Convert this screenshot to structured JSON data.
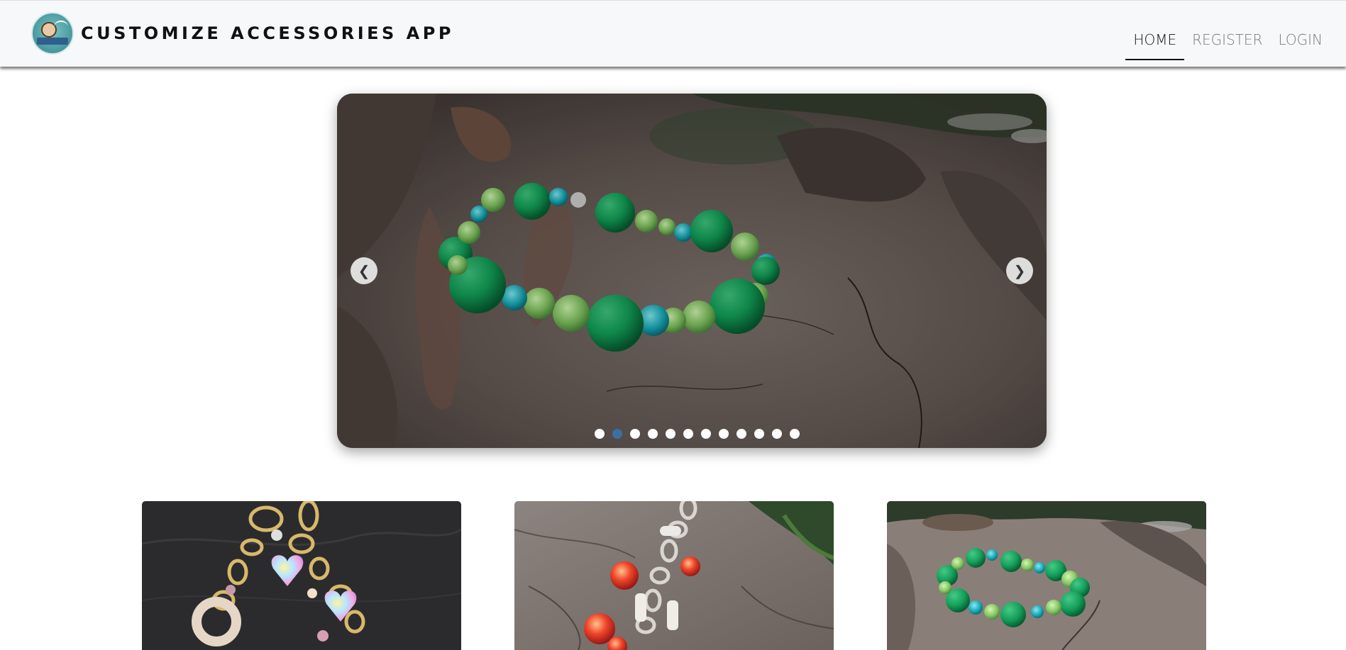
{
  "header": {
    "brand_title": "CUSTOMIZE ACCESSORIES APP",
    "logo_icon": "brand-logo-icon",
    "nav": [
      {
        "label": "HOME",
        "active": true
      },
      {
        "label": "REGISTER",
        "active": false
      },
      {
        "label": "LOGIN",
        "active": false
      }
    ]
  },
  "carousel": {
    "prev_symbol": "❮",
    "next_symbol": "❯",
    "slide_count": 12,
    "active_slide": 2,
    "dot_color": "#ffffff",
    "active_dot_color": "#3b6fa5",
    "slide_subject": "green-bead-bracelet-image"
  },
  "products": [
    {
      "image": "gold-chain-heart-charm-bracelet-image"
    },
    {
      "image": "silver-chain-red-crystal-bracelet-image"
    },
    {
      "image": "green-bead-bracelet-image"
    }
  ]
}
